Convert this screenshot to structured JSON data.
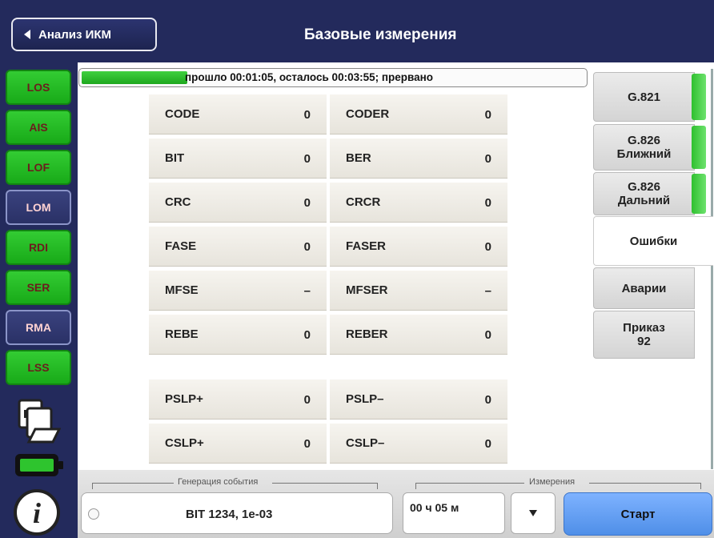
{
  "header": {
    "back_label": "Анализ ИКМ",
    "title": "Базовые измерения"
  },
  "indicators": [
    {
      "label": "LOS",
      "state": "on"
    },
    {
      "label": "AIS",
      "state": "on"
    },
    {
      "label": "LOF",
      "state": "on"
    },
    {
      "label": "LOM",
      "state": "off"
    },
    {
      "label": "RDI",
      "state": "on"
    },
    {
      "label": "SER",
      "state": "on"
    },
    {
      "label": "RMA",
      "state": "off"
    },
    {
      "label": "LSS",
      "state": "on"
    }
  ],
  "progress": {
    "text": "прошло 00:01:05, осталось 00:03:55; прервано",
    "fraction": 0.21
  },
  "grid": [
    {
      "l1": "CODE",
      "v1": "0",
      "l2": "CODER",
      "v2": "0"
    },
    {
      "l1": "BIT",
      "v1": "0",
      "l2": "BER",
      "v2": "0"
    },
    {
      "l1": "CRC",
      "v1": "0",
      "l2": "CRCR",
      "v2": "0"
    },
    {
      "l1": "FASE",
      "v1": "0",
      "l2": "FASER",
      "v2": "0"
    },
    {
      "l1": "MFSE",
      "v1": "–",
      "l2": "MFSER",
      "v2": "–"
    },
    {
      "l1": "REBE",
      "v1": "0",
      "l2": "REBER",
      "v2": "0"
    },
    {
      "l1": "PSLP+",
      "v1": "0",
      "l2": "PSLP–",
      "v2": "0"
    },
    {
      "l1": "CSLP+",
      "v1": "0",
      "l2": "CSLP–",
      "v2": "0"
    }
  ],
  "tabs": [
    {
      "label": "G.821",
      "active": false,
      "bar": true
    },
    {
      "label": "G.826\nБлижний",
      "active": false,
      "bar": true
    },
    {
      "label": "G.826\nДальний",
      "active": false,
      "bar": true
    },
    {
      "label": "Ошибки",
      "active": true,
      "bar": false
    },
    {
      "label": "Аварии",
      "active": false,
      "bar": false
    },
    {
      "label": "Приказ\n92",
      "active": false,
      "bar": false
    }
  ],
  "bottom": {
    "event_group_label": "Генерация события",
    "event_text": "BIT  1234, 1e-03",
    "measure_group_label": "Измерения",
    "duration": "00 ч 05 м",
    "start_label": "Старт"
  },
  "colors": {
    "header_bg": "#232a5c",
    "indicator_on": "#22bb22",
    "start_button": "#5f9cf0"
  },
  "icons": [
    "back-triangle-icon",
    "documents-icon",
    "battery-icon",
    "info-icon",
    "dropdown-arrow-icon"
  ]
}
